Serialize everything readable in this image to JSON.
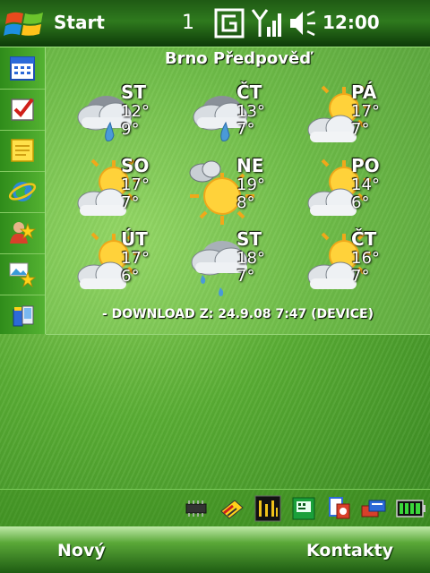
{
  "titlebar": {
    "start_label": "Start",
    "notification_count": "1",
    "time": "12:00",
    "icons": [
      "windows-flag-icon",
      "gprs-icon",
      "signal-icon",
      "speaker-icon"
    ]
  },
  "sidebar": {
    "items": [
      {
        "name": "calendar-icon"
      },
      {
        "name": "tasks-icon"
      },
      {
        "name": "notes-icon"
      },
      {
        "name": "internet-explorer-icon"
      },
      {
        "name": "contacts-icon"
      },
      {
        "name": "pictures-icon"
      },
      {
        "name": "programs-icon"
      }
    ]
  },
  "weather": {
    "city": "Brno Předpověď",
    "days": [
      {
        "day": "ST",
        "high": "12°",
        "low": "9°",
        "icon": "cloud-rain-icon"
      },
      {
        "day": "ČT",
        "high": "13°",
        "low": "7°",
        "icon": "cloud-rain-icon"
      },
      {
        "day": "PÁ",
        "high": "17°",
        "low": "7°",
        "icon": "sun-cloud-icon"
      },
      {
        "day": "SO",
        "high": "17°",
        "low": "7°",
        "icon": "sun-cloud-icon"
      },
      {
        "day": "NE",
        "high": "19°",
        "low": "8°",
        "icon": "sun-small-cloud-icon"
      },
      {
        "day": "PO",
        "high": "14°",
        "low": "6°",
        "icon": "sun-cloud-icon"
      },
      {
        "day": "ÚT",
        "high": "17°",
        "low": "6°",
        "icon": "sun-cloud-icon"
      },
      {
        "day": "ST",
        "high": "18°",
        "low": "7°",
        "icon": "cloud-drizzle-icon"
      },
      {
        "day": "ČT",
        "high": "16°",
        "low": "7°",
        "icon": "sun-cloud-icon"
      }
    ],
    "download_text": "- DOWNLOAD Z: 24.9.08 7:47 (DEVICE)"
  },
  "tray": {
    "icons": [
      "memory-chip-icon",
      "cleaner-icon",
      "binary-clock-icon",
      "phone-app-icon",
      "media-icon",
      "network-icon",
      "battery-icon"
    ]
  },
  "softkeys": {
    "left": "Nový",
    "right": "Kontakty"
  },
  "colors": {
    "accent": "#4a9a2c",
    "title_bar": "#1f5a14"
  }
}
